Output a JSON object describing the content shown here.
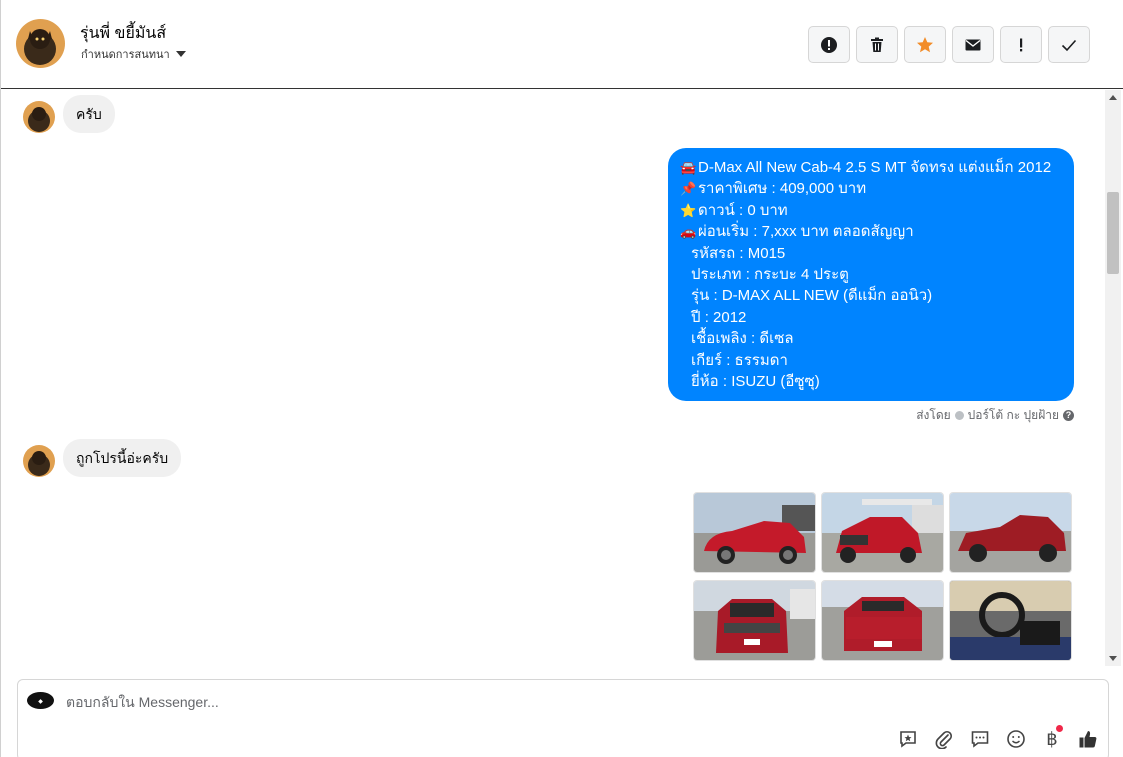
{
  "header": {
    "contact_name": "รุ่นพี่ ขยี้มันส์",
    "assign_label": "กำหนดการสนทนา",
    "actions": [
      {
        "name": "spam-button",
        "icon": "exclamation-circle-icon"
      },
      {
        "name": "delete-button",
        "icon": "trash-icon"
      },
      {
        "name": "star-button",
        "icon": "star-icon"
      },
      {
        "name": "mark-unread-button",
        "icon": "envelope-icon"
      },
      {
        "name": "follow-up-button",
        "icon": "exclamation-icon"
      },
      {
        "name": "done-button",
        "icon": "checkmark-icon"
      }
    ]
  },
  "messages": {
    "msg1": "ครับ",
    "offer": {
      "lines": [
        {
          "emoji": "🚘",
          "text": "D-Max All New Cab-4 2.5 S MT จัดทรง แต่งแม็ก 2012"
        },
        {
          "emoji": "📌",
          "text": "ราคาพิเศษ : 409,000 บาท"
        },
        {
          "emoji": "⭐",
          "text": "ดาวน์ : 0 บาท"
        },
        {
          "emoji": "🚗",
          "text": "ผ่อนเริ่ม : 7,xxx บาท ตลอดสัญญา"
        },
        {
          "emoji": "",
          "text": "รหัสรถ : M015"
        },
        {
          "emoji": "",
          "text": "ประเภท : กระบะ 4 ประตู"
        },
        {
          "emoji": "",
          "text": "รุ่น : D-MAX ALL NEW (ดีแม็ก ออนิว)"
        },
        {
          "emoji": "",
          "text": "ปี : 2012"
        },
        {
          "emoji": "",
          "text": "เชื้อเพลิง : ดีเซล"
        },
        {
          "emoji": "",
          "text": "เกียร์ : ธรรมดา"
        },
        {
          "emoji": "",
          "text": "ยี่ห้อ : ISUZU (อีซูซุ)"
        }
      ],
      "sent_by_label": "ส่งโดย",
      "sent_by_name": "ปอร์โต้ กะ ปุยฝ้าย"
    },
    "msg2": "ถูกโปรนี้อ่ะครับ",
    "photos": [
      "car-photo-1",
      "car-photo-2",
      "car-photo-3",
      "car-photo-4",
      "car-photo-5",
      "car-photo-6"
    ]
  },
  "composer": {
    "placeholder": "ตอบกลับใน Messenger...",
    "tools": [
      "saved-reply-icon",
      "attachment-icon",
      "chat-bubble-icon",
      "emoji-icon",
      "baht-icon",
      "like-icon"
    ],
    "baht_symbol": "฿"
  },
  "colors": {
    "outgoing_bubble": "#0084ff",
    "incoming_bubble": "#f0f0f0",
    "star": "#f28c28"
  }
}
